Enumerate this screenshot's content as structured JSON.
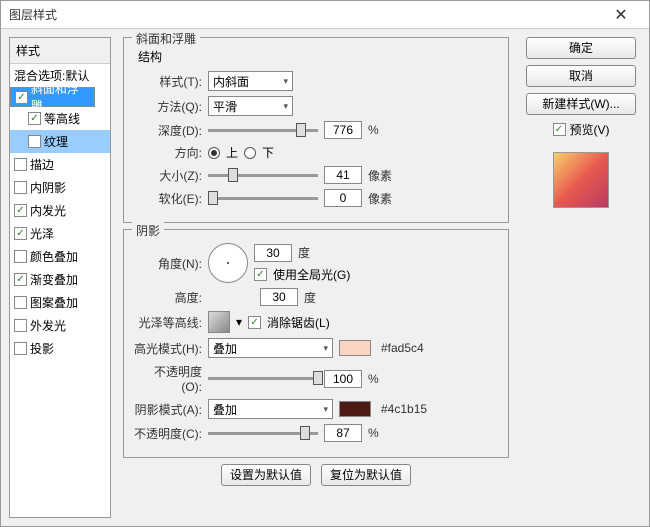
{
  "title": "图层样式",
  "buttons": {
    "ok": "确定",
    "cancel": "取消",
    "newstyle": "新建样式(W)...",
    "preview": "预览(V)",
    "default1": "设置为默认值",
    "default2": "复位为默认值"
  },
  "styles": {
    "header": "样式",
    "blend": "混合选项:默认",
    "items": [
      {
        "label": "斜面和浮雕",
        "ck": true,
        "sel": true
      },
      {
        "label": "等高线",
        "ck": true,
        "sub": true
      },
      {
        "label": "纹理",
        "ck": false,
        "sub": true,
        "sel2": true
      },
      {
        "label": "描边",
        "ck": false
      },
      {
        "label": "内阴影",
        "ck": false
      },
      {
        "label": "内发光",
        "ck": true
      },
      {
        "label": "光泽",
        "ck": true
      },
      {
        "label": "颜色叠加",
        "ck": false
      },
      {
        "label": "渐变叠加",
        "ck": true
      },
      {
        "label": "图案叠加",
        "ck": false
      },
      {
        "label": "外发光",
        "ck": false
      },
      {
        "label": "投影",
        "ck": false
      }
    ]
  },
  "bevel": {
    "group": "斜面和浮雕",
    "struct": "结构",
    "style_l": "样式(T):",
    "style_v": "内斜面",
    "tech_l": "方法(Q):",
    "tech_v": "平滑",
    "depth_l": "深度(D):",
    "depth_v": "776",
    "pct": "%",
    "dir_l": "方向:",
    "up": "上",
    "down": "下",
    "size_l": "大小(Z):",
    "size_v": "41",
    "px": "像素",
    "soft_l": "软化(E):",
    "soft_v": "0"
  },
  "shadow": {
    "group": "阴影",
    "angle_l": "角度(N):",
    "angle_v": "30",
    "deg": "度",
    "global": "使用全局光(G)",
    "alt_l": "高度:",
    "alt_v": "30",
    "gloss_l": "光泽等高线:",
    "aa": "消除锯齿(L)",
    "hi_l": "高光模式(H):",
    "hi_m": "叠加",
    "hi_c": "#fad5c4",
    "hi_hex": "#fad5c4",
    "hi_op_l": "不透明度(O):",
    "hi_op_v": "100",
    "sh_l": "阴影模式(A):",
    "sh_m": "叠加",
    "sh_c": "#4c1b15",
    "sh_hex": "#4c1b15",
    "sh_op_l": "不透明度(C):",
    "sh_op_v": "87"
  }
}
